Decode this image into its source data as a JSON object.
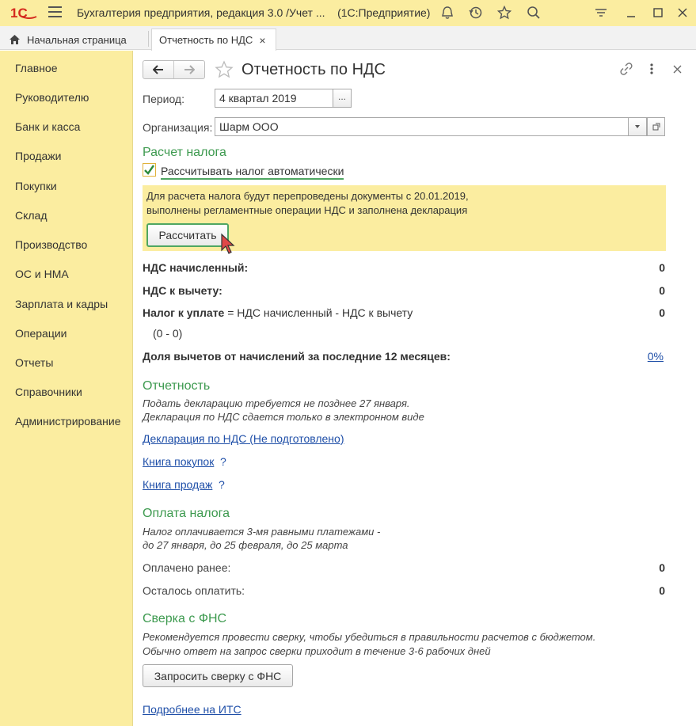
{
  "titlebar": {
    "logo_text": "1С",
    "title": "Бухгалтерия предприятия, редакция 3.0 /Учет ...",
    "platform": "(1С:Предприятие)"
  },
  "tabs": {
    "home_label": "Начальная страница",
    "active_label": "Отчетность по НДС",
    "close_glyph": "×"
  },
  "sidebar": {
    "items": [
      "Главное",
      "Руководителю",
      "Банк и касса",
      "Продажи",
      "Покупки",
      "Склад",
      "Производство",
      "ОС и НМА",
      "Зарплата и кадры",
      "Операции",
      "Отчеты",
      "Справочники",
      "Администрирование"
    ]
  },
  "form": {
    "title": "Отчетность по НДС",
    "period_label": "Период:",
    "period_value": "4 квартал 2019",
    "ellipsis": "...",
    "org_label": "Организация:",
    "org_value": "Шарм ООО"
  },
  "tax_calc": {
    "title": "Расчет налога",
    "auto_checkbox_label": "Рассчитывать налог автоматически",
    "auto_checked": true,
    "notice_line1": "Для расчета налога будут перепроведены документы с 20.01.2019,",
    "notice_line2": "выполнены регламентные операции НДС и заполнена декларация",
    "calc_button": "Рассчитать",
    "vat_accrued_label": "НДС начисленный:",
    "vat_accrued_value": "0",
    "vat_deduct_label": "НДС к вычету:",
    "vat_deduct_value": "0",
    "tax_payable_label": "Налог к уплате",
    "tax_payable_formula": "= НДС начисленный - НДС к вычету",
    "tax_payable_value": "0",
    "formula_values": "(0 - 0)",
    "share_label": "Доля вычетов от начислений за последние 12 месяцев:",
    "share_value": "0%"
  },
  "reporting": {
    "title": "Отчетность",
    "note_line1": "Подать декларацию требуется не позднее 27 января.",
    "note_line2": "Декларация по НДС сдается только в электронном виде",
    "declaration_link": "Декларация по НДС (Не подготовлено)",
    "purchase_book_link": "Книга покупок",
    "sales_book_link": "Книга продаж",
    "help_glyph": "?"
  },
  "payment": {
    "title": "Оплата налога",
    "note_line1": "Налог оплачивается 3-мя равными платежами -",
    "note_line2": "до 27 января, до 25 февраля, до 25 марта",
    "paid_label": "Оплачено ранее:",
    "paid_value": "0",
    "remaining_label": "Осталось оплатить:",
    "remaining_value": "0"
  },
  "fns_check": {
    "title": "Сверка с ФНС",
    "note_line1": "Рекомендуется провести сверку, чтобы убедиться в правильности расчетов с бюджетом.",
    "note_line2": "Обычно ответ на запрос сверки приходит в течение 3-6 рабочих дней",
    "request_button": "Запросить сверку с ФНС",
    "its_link": "Подробнее на ИТС"
  },
  "colors": {
    "accent_yellow": "#fbeda0",
    "section_green": "#3d9a4f",
    "link_blue": "#1f4fa8",
    "logo_red": "#d42b1e"
  },
  "icons": [
    "1c-logo",
    "menu-icon",
    "bell-icon",
    "history-icon",
    "star-icon",
    "search-icon",
    "settings-icon",
    "minimize-icon",
    "maximize-icon",
    "close-icon",
    "home-icon",
    "back-arrow-icon",
    "forward-arrow-icon",
    "favorite-star-icon",
    "link-icon",
    "more-icon",
    "dropdown-arrow-icon",
    "open-icon",
    "cursor-icon"
  ]
}
